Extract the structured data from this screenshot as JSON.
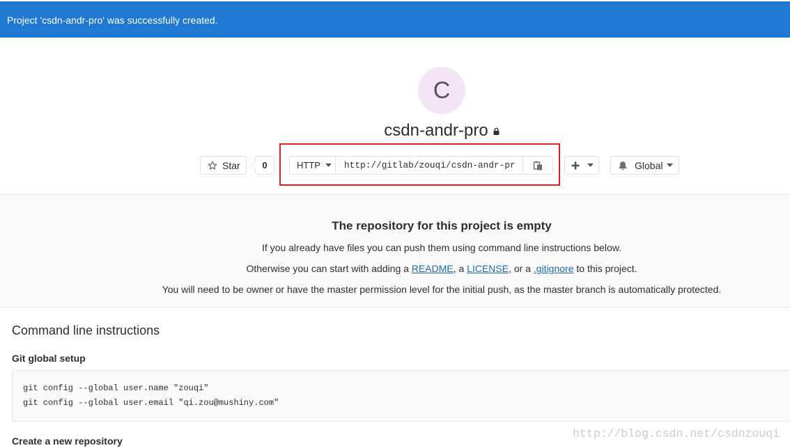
{
  "flash": {
    "message": "Project 'csdn-andr-pro' was successfully created.",
    "color": "#1f78d1"
  },
  "project": {
    "avatar_letter": "C",
    "name": "csdn-andr-pro",
    "visibility_icon": "lock-icon"
  },
  "actions": {
    "star": {
      "icon": "star-icon",
      "label": "Star",
      "count": "0"
    },
    "clone": {
      "protocol": "HTTP",
      "protocol_icon": "caret-down-icon",
      "url": "http://gitlab/zouqi/csdn-andr-pr",
      "copy_icon": "clipboard-icon"
    },
    "add": {
      "icon": "plus-icon",
      "caret_icon": "caret-down-icon"
    },
    "notifications": {
      "icon": "bell-icon",
      "label": "Global",
      "caret_icon": "caret-down-icon"
    }
  },
  "highlight": {
    "color": "#e61e1e"
  },
  "empty_state": {
    "title": "The repository for this project is empty",
    "line1": "If you already have files you can push them using command line instructions below.",
    "line2": {
      "before": "Otherwise you can start with adding a ",
      "readme": "README",
      "sep1": ", a ",
      "license": "LICENSE",
      "sep2": ", or a ",
      "gitignore": ".gitignore",
      "after": " to this project."
    },
    "line3": "You will need to be owner or have the master permission level for the initial push, as the master branch is automatically protected.",
    "link_color": "#1b69b6"
  },
  "instructions": {
    "title": "Command line instructions",
    "sections": [
      {
        "title": "Git global setup",
        "code": [
          "git config --global user.name \"zouqi\"",
          "git config --global user.email \"qi.zou@mushiny.com\""
        ]
      },
      {
        "title": "Create a new repository"
      }
    ]
  },
  "watermark": "http://blog.csdn.net/csdnzouqi"
}
